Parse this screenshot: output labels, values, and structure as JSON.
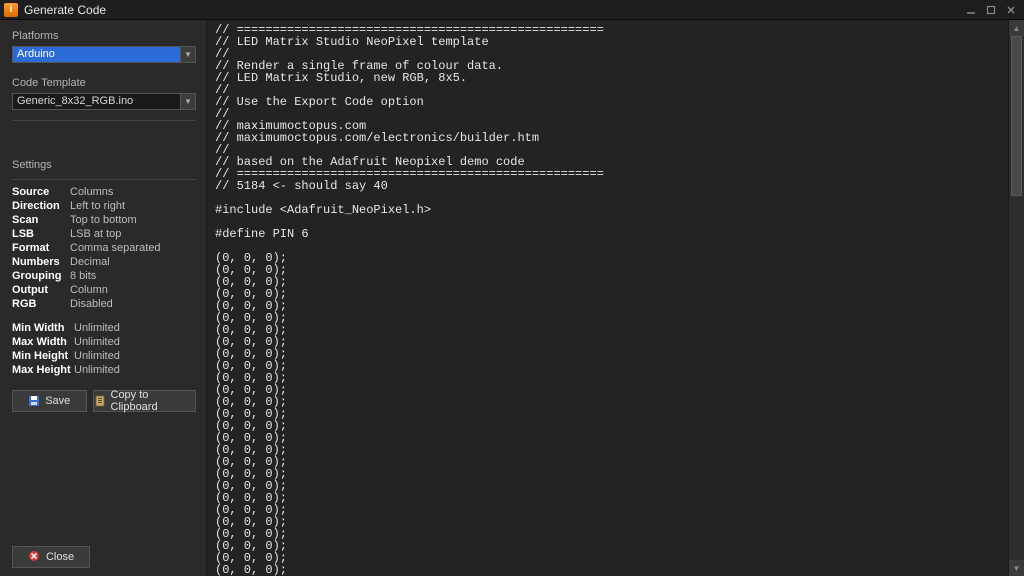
{
  "window": {
    "title": "Generate Code"
  },
  "sidebar": {
    "platforms_label": "Platforms",
    "platform_value": "Arduino",
    "template_label": "Code Template",
    "template_value": "Generic_8x32_RGB.ino",
    "settings_label": "Settings",
    "settings": [
      {
        "k": "Source",
        "v": "Columns"
      },
      {
        "k": "Direction",
        "v": "Left to right"
      },
      {
        "k": "Scan",
        "v": "Top to bottom"
      },
      {
        "k": "LSB",
        "v": "LSB at top"
      },
      {
        "k": "Format",
        "v": "Comma separated"
      },
      {
        "k": "Numbers",
        "v": "Decimal"
      },
      {
        "k": "Grouping",
        "v": "8 bits"
      },
      {
        "k": "Output",
        "v": "Column"
      },
      {
        "k": "RGB",
        "v": "Disabled"
      }
    ],
    "limits": [
      {
        "k": "Min Width",
        "v": "Unlimited"
      },
      {
        "k": "Max Width",
        "v": "Unlimited"
      },
      {
        "k": "Min Height",
        "v": "Unlimited"
      },
      {
        "k": "Max Height",
        "v": "Unlimited"
      }
    ],
    "save_label": "Save",
    "copy_label": "Copy to Clipboard",
    "close_label": "Close"
  },
  "code": {
    "text": "// ===================================================\n// LED Matrix Studio NeoPixel template\n//\n// Render a single frame of colour data.\n// LED Matrix Studio, new RGB, 8x5.\n//\n// Use the Export Code option\n//\n// maximumoctopus.com\n// maximumoctopus.com/electronics/builder.htm\n//\n// based on the Adafruit Neopixel demo code\n// ===================================================\n// 5184 <- should say 40\n\n#include <Adafruit_NeoPixel.h>\n\n#define PIN 6\n\n(0, 0, 0);\n(0, 0, 0);\n(0, 0, 0);\n(0, 0, 0);\n(0, 0, 0);\n(0, 0, 0);\n(0, 0, 0);\n(0, 0, 0);\n(0, 0, 0);\n(0, 0, 0);\n(0, 0, 0);\n(0, 0, 0);\n(0, 0, 0);\n(0, 0, 0);\n(0, 0, 0);\n(0, 0, 0);\n(0, 0, 0);\n(0, 0, 0);\n(0, 0, 0);\n(0, 0, 0);\n(0, 0, 0);\n(0, 0, 0);\n(0, 0, 0);\n(0, 0, 0);\n(0, 0, 0);\n(0, 0, 0);\n(0, 0, 0);"
  },
  "colors": {
    "selection": "#2a6bd8",
    "panel": "#2a2a2a",
    "code_bg": "#232323"
  }
}
